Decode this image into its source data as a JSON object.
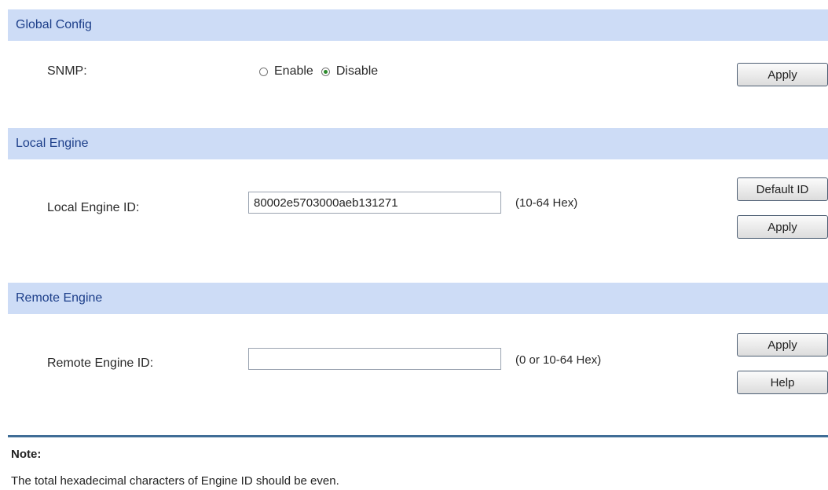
{
  "global_config": {
    "title": "Global Config",
    "snmp_label": "SNMP:",
    "enable_label": "Enable",
    "disable_label": "Disable",
    "selected": "Disable",
    "apply_label": "Apply"
  },
  "local_engine": {
    "title": "Local Engine",
    "id_label": "Local Engine ID:",
    "id_value": "80002e5703000aeb131271",
    "hint": "(10-64 Hex)",
    "default_id_label": "Default ID",
    "apply_label": "Apply"
  },
  "remote_engine": {
    "title": "Remote Engine",
    "id_label": "Remote Engine ID:",
    "id_value": "",
    "hint": "(0 or 10-64 Hex)",
    "apply_label": "Apply",
    "help_label": "Help"
  },
  "note": {
    "title": "Note:",
    "text": "The total hexadecimal characters of Engine ID should be even."
  }
}
